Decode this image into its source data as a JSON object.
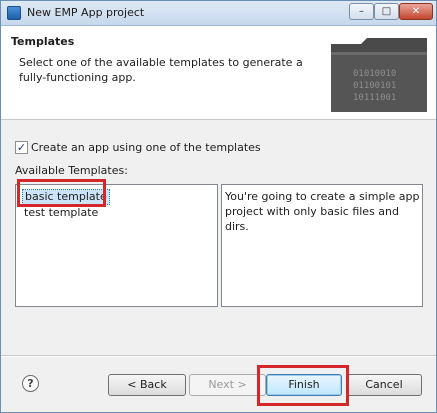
{
  "window": {
    "title": "New EMP App project"
  },
  "header": {
    "title": "Templates",
    "description": "Select one of the available templates to generate a fully-functioning app.",
    "banner_binary": [
      "01010010",
      "01100101",
      "10111001"
    ]
  },
  "options": {
    "use_template_label": "Create an app using one of the templates",
    "use_template_checked": true,
    "available_label": "Available Templates:"
  },
  "templates": [
    {
      "label": "basic template",
      "selected": true
    },
    {
      "label": "test template",
      "selected": false
    }
  ],
  "template_description": "You're going to create a simple app project with only basic files and dirs.",
  "buttons": {
    "help": "?",
    "back": "< Back",
    "next": "Next >",
    "finish": "Finish",
    "cancel": "Cancel"
  },
  "colors": {
    "highlight": "#d4262b",
    "selection": "#cce4f7"
  }
}
